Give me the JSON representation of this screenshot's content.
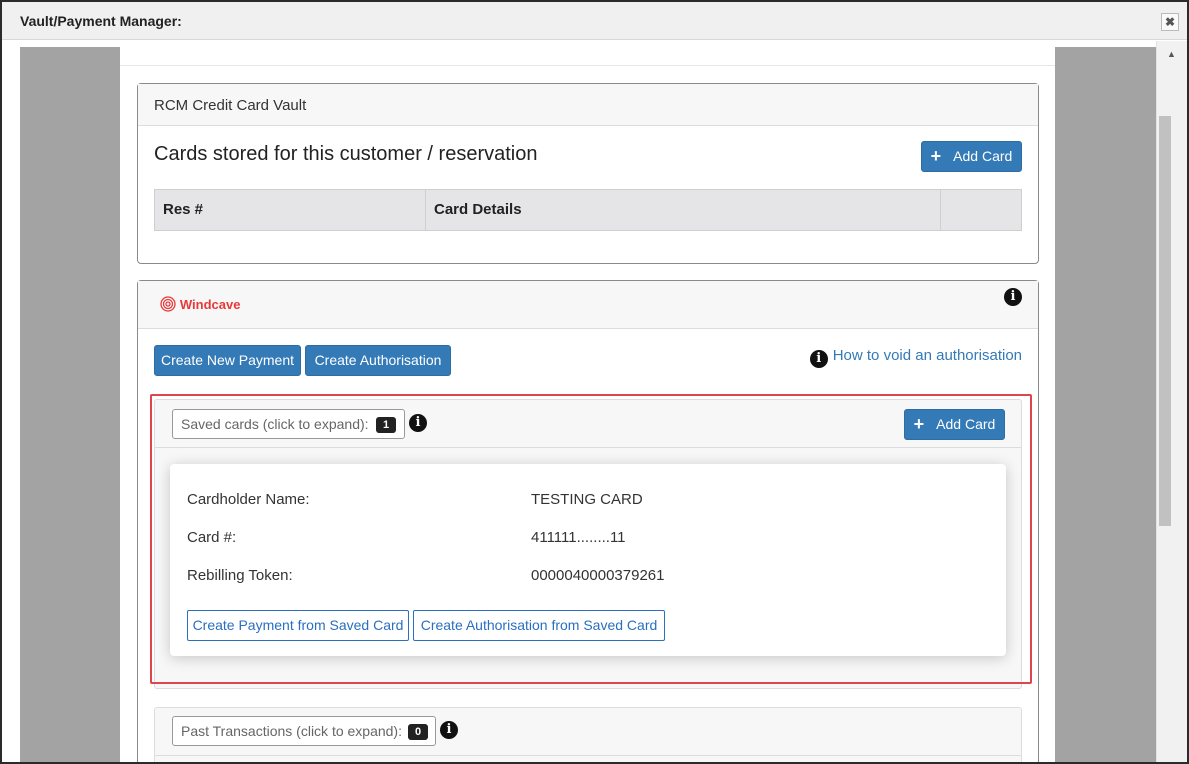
{
  "window": {
    "title": "Vault/Payment Manager:",
    "close_glyph": "✖"
  },
  "rcm_vault": {
    "header": "RCM Credit Card Vault",
    "subtitle": "Cards stored for this customer / reservation",
    "add_card_label": "Add Card",
    "table_columns": [
      "Res #",
      "Card Details",
      ""
    ]
  },
  "windcave": {
    "logo_text": "Windcave",
    "create_payment_label": "Create New Payment",
    "create_auth_label": "Create Authorisation",
    "void_link_label": "How to void an authorisation",
    "saved_cards": {
      "toggle_label": "Saved cards (click to expand):",
      "count": "1",
      "add_card_label": "Add Card",
      "card": {
        "cardholder_label": "Cardholder Name:",
        "cardholder_value": "TESTING CARD",
        "card_number_label": "Card #:",
        "card_number_value": "411111........11",
        "token_label": "Rebilling Token:",
        "token_value": "0000040000379261",
        "create_payment_label": "Create Payment from Saved Card",
        "create_auth_label": "Create Authorisation from Saved Card"
      }
    },
    "past_transactions": {
      "toggle_label": "Past Transactions (click to expand):",
      "count": "0"
    }
  },
  "colors": {
    "primary": "#337ab7",
    "highlight": "#e0444d",
    "windcave_red": "#e8393a",
    "link": "#2a6fc0"
  }
}
